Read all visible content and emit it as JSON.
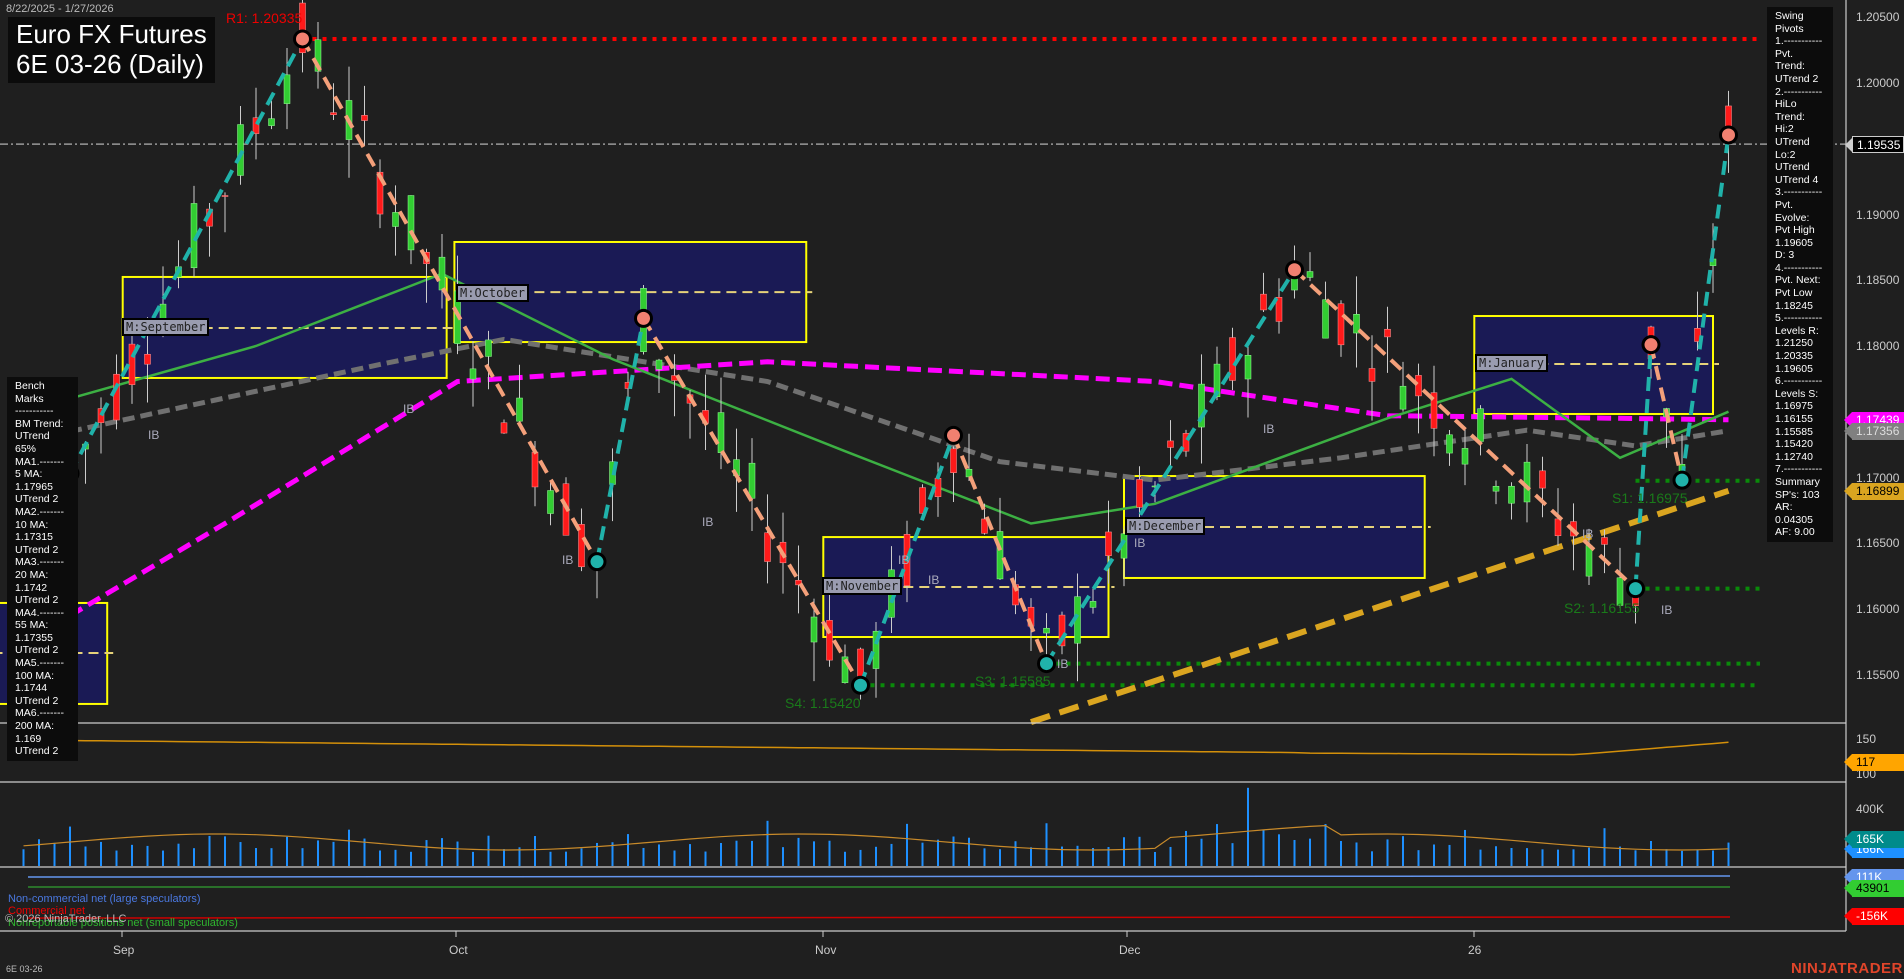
{
  "header": {
    "date_range": "8/22/2025 - 1/27/2026",
    "title_line1": "Euro FX Futures",
    "title_line2": "6E 03-26 (Daily)"
  },
  "swing_panel": {
    "lines": [
      "Swing Pivots",
      "1.-----------",
      "Pvt. Trend:",
      "UTrend 2",
      "2.-----------",
      "HiLo Trend:",
      "Hi:2 UTrend",
      "Lo:2 UTrend",
      "UTrend 4",
      "3.-----------",
      "Pvt. Evolve:",
      "Pvt High",
      "1.19605",
      "D: 3",
      "4.-----------",
      "Pvt. Next:",
      "Pvt Low",
      "1.18245",
      "5.-----------",
      "Levels R:",
      "1.21250",
      "1.20335",
      "1.19605",
      "6.-----------",
      "Levels S:",
      "1.16975",
      "1.16155",
      "1.15585",
      "1.15420",
      "1.12740",
      "7.-----------",
      "Summary",
      "SP's: 103",
      "AR: 0.04305",
      "AF: 9.00"
    ]
  },
  "bench_panel": {
    "lines": [
      "Bench Marks",
      "-----------",
      "BM Trend:",
      "UTrend 65%",
      "MA1.-------",
      "5 MA:",
      "1.17965",
      "UTrend 2",
      "MA2.-------",
      "10 MA:",
      "1.17315",
      "UTrend 2",
      "MA3.-------",
      "20 MA:",
      "1.1742",
      "UTrend 2",
      "MA4.-------",
      "55 MA:",
      "1.17355",
      "UTrend 2",
      "MA5.-------",
      "100 MA:",
      "1.1744",
      "UTrend 2",
      "MA6.-------",
      "200 MA:",
      "1.169",
      "UTrend 2"
    ]
  },
  "levels": {
    "r1": "R1: 1.20335",
    "s1": "S1: 1.16975",
    "s2": "S2: 1.16155",
    "s3": "S3: 1.15585",
    "s4": "S4: 1.15420"
  },
  "month_labels": [
    "M:September",
    "M:October",
    "M:November",
    "M:December",
    "M:January"
  ],
  "ib_label": "IB",
  "x_axis": {
    "labels": [
      "Sep",
      "Oct",
      "Nov",
      "Dec",
      "26"
    ]
  },
  "y_axis": {
    "ticks": [
      "1.20500",
      "1.20000",
      "1.19000",
      "1.18500",
      "1.18000",
      "1.17000",
      "1.16500",
      "1.16000",
      "1.15500"
    ]
  },
  "price_tags": [
    {
      "value": "1.19535",
      "color": "#000000",
      "text": "#ffffff"
    },
    {
      "value": "1.17439",
      "color": "#ff00ff",
      "text": "#ffffff"
    },
    {
      "value": "1.17356",
      "color": "#808080",
      "text": "#dddddd"
    },
    {
      "value": "1.16899",
      "color": "#daa520",
      "text": "#000000"
    }
  ],
  "indicator_panel": {
    "ticks": [
      "150",
      "100"
    ],
    "tag": "117",
    "tag_color": "#ffa500"
  },
  "volume_panel": {
    "ticks": [
      "400K"
    ],
    "tag": "165K",
    "tag_color": "#008b8b",
    "tag2": "166K",
    "tag2_color": "#1e90ff"
  },
  "cot_panel": {
    "legend": [
      "Non-commercial net (large speculators)",
      "Commercial net",
      "Nonreportable positions net (small speculators)"
    ],
    "colors": [
      "#4169e1",
      "#ff0000",
      "#32cd32"
    ],
    "tags": [
      "111K",
      "43901",
      "-156K"
    ]
  },
  "footer": {
    "copyright": "© 2026 NinjaTrader, LLC",
    "instrument": "6E 03-26",
    "logo": "NINJATRADER"
  },
  "chart_data": {
    "type": "candlestick",
    "title": "Euro FX Futures 6E 03-26 (Daily)",
    "x_range_bars": [
      0,
      107
    ],
    "ylim": [
      1.1505,
      1.2065
    ],
    "swing_points": [
      {
        "bar": 0,
        "price": 1.1703
      },
      {
        "bar": 15,
        "price": 1.20335
      },
      {
        "bar": 34,
        "price": 1.1636
      },
      {
        "bar": 37,
        "price": 1.1821
      },
      {
        "bar": 51,
        "price": 1.1542
      },
      {
        "bar": 57,
        "price": 1.1732
      },
      {
        "bar": 63,
        "price": 1.15585
      },
      {
        "bar": 79,
        "price": 1.1858
      },
      {
        "bar": 101,
        "price": 1.16155
      },
      {
        "bar": 102,
        "price": 1.1801
      },
      {
        "bar": 104,
        "price": 1.1698
      },
      {
        "bar": 107,
        "price": 1.19605
      }
    ],
    "last_price": 1.19535,
    "ma_200": [
      [
        0,
        1.1595
      ],
      [
        10,
        1.1665
      ],
      [
        25,
        1.1773
      ],
      [
        45,
        1.1788
      ],
      [
        70,
        1.1773
      ],
      [
        85,
        1.1747
      ],
      [
        100,
        1.1745
      ],
      [
        107,
        1.17439
      ]
    ],
    "ma_100": [
      [
        0,
        1.1735
      ],
      [
        20,
        1.1786
      ],
      [
        28,
        1.1805
      ],
      [
        45,
        1.1773
      ],
      [
        60,
        1.1712
      ],
      [
        70,
        1.1698
      ],
      [
        82,
        1.1715
      ],
      [
        94,
        1.1736
      ],
      [
        101,
        1.1724
      ],
      [
        107,
        1.17356
      ]
    ],
    "ma_20": [
      [
        0,
        1.176
      ],
      [
        12,
        1.18
      ],
      [
        24,
        1.1855
      ],
      [
        35,
        1.179
      ],
      [
        50,
        1.172
      ],
      [
        62,
        1.1665
      ],
      [
        70,
        1.168
      ],
      [
        85,
        1.1745
      ],
      [
        93,
        1.1775
      ],
      [
        100,
        1.1715
      ],
      [
        107,
        1.175
      ]
    ],
    "trendline": [
      [
        62,
        1.1514
      ],
      [
        107,
        1.16899
      ]
    ],
    "value_boxes": [
      {
        "from": -5,
        "to": 2.4,
        "high": 1.16046,
        "low": 1.15278,
        "mid": 1.15665
      },
      {
        "from": 3.4,
        "to": 24.3,
        "high": 1.18525,
        "low": 1.17757,
        "mid": 1.18137
      },
      {
        "from": 24.8,
        "to": 47.5,
        "high": 1.18791,
        "low": 1.1803,
        "mid": 1.1841
      },
      {
        "from": 48.6,
        "to": 67,
        "high": 1.16547,
        "low": 1.15787,
        "mid": 1.16167
      },
      {
        "from": 68,
        "to": 87.4,
        "high": 1.17011,
        "low": 1.16236,
        "mid": 1.16624
      },
      {
        "from": 90.6,
        "to": 106,
        "high": 1.18228,
        "low": 1.17483,
        "mid": 1.17863
      }
    ],
    "support_levels": [
      1.16975,
      1.16155,
      1.15585,
      1.1542
    ],
    "resistance_levels": [
      1.20335
    ],
    "indicator_value": 117,
    "volume_last": 165000,
    "cot_last": {
      "noncommercial": 111000,
      "nonreportable": 43901,
      "commercial": -156000
    }
  }
}
